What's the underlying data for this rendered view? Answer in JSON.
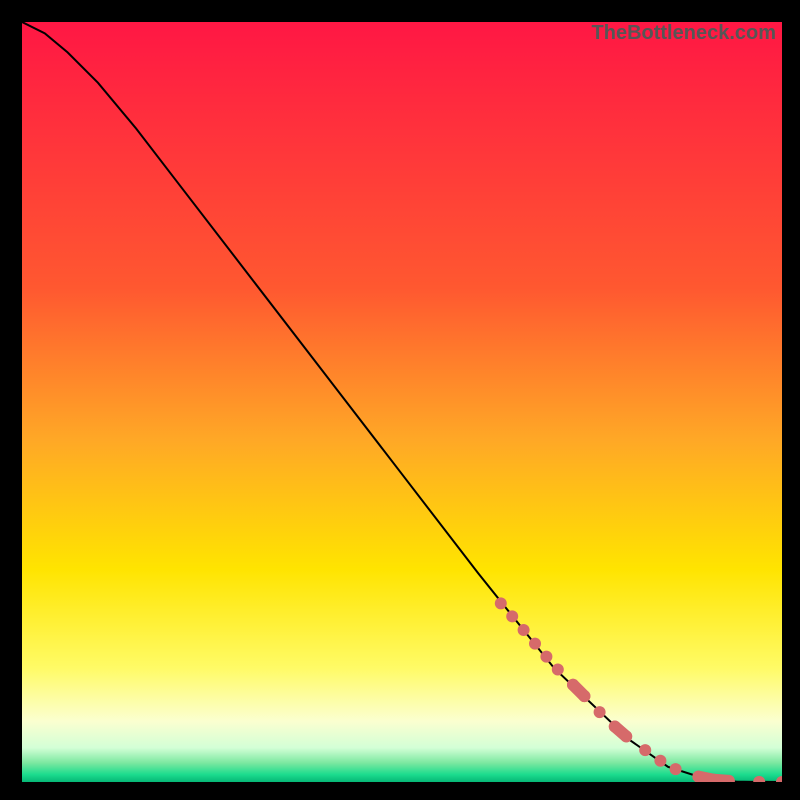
{
  "watermark": "TheBottleneck.com",
  "chart_data": {
    "type": "line",
    "title": "",
    "xlabel": "",
    "ylabel": "",
    "xlim": [
      0,
      100
    ],
    "ylim": [
      0,
      100
    ],
    "curve": {
      "x": [
        0,
        3,
        6,
        10,
        15,
        20,
        30,
        40,
        50,
        60,
        70,
        80,
        85,
        90,
        92,
        94,
        96,
        98,
        100
      ],
      "y": [
        100,
        98.5,
        96,
        92,
        86,
        79.5,
        66.5,
        53.5,
        40.5,
        27.5,
        15,
        5.5,
        2,
        0.4,
        0.15,
        0.05,
        0.02,
        0.01,
        0
      ]
    },
    "series": [
      {
        "name": "points",
        "x": [
          63,
          64.5,
          66,
          67.5,
          69,
          70.5,
          72.5,
          74,
          76,
          78,
          79.5,
          82,
          84,
          86,
          89,
          91,
          93,
          97,
          100
        ],
        "y": [
          23.5,
          21.8,
          20.0,
          18.2,
          16.5,
          14.8,
          12.8,
          11.3,
          9.2,
          7.3,
          6.0,
          4.2,
          2.8,
          1.7,
          0.7,
          0.3,
          0.15,
          0.02,
          0
        ],
        "point_size": 8,
        "color": "#d66a6a"
      }
    ],
    "gradient_bands": [
      {
        "stop": 0.0,
        "color": "#ff1744"
      },
      {
        "stop": 0.35,
        "color": "#ff5830"
      },
      {
        "stop": 0.55,
        "color": "#ffa826"
      },
      {
        "stop": 0.72,
        "color": "#ffe400"
      },
      {
        "stop": 0.85,
        "color": "#fffb66"
      },
      {
        "stop": 0.92,
        "color": "#fbffd0"
      },
      {
        "stop": 0.955,
        "color": "#d3ffd6"
      },
      {
        "stop": 0.975,
        "color": "#7be8a0"
      },
      {
        "stop": 0.99,
        "color": "#1cdc8e"
      },
      {
        "stop": 1.0,
        "color": "#06b876"
      }
    ]
  }
}
